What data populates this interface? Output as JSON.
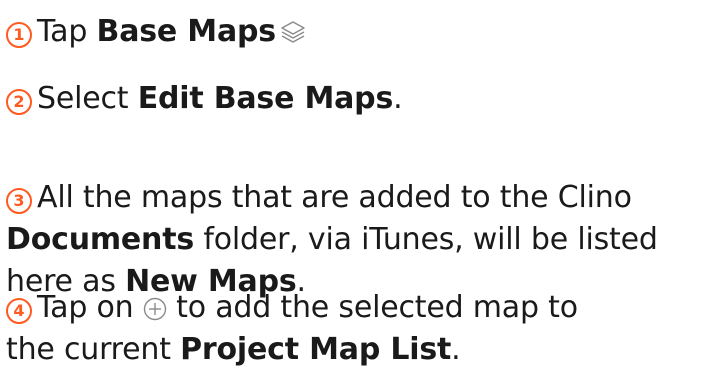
{
  "colors": {
    "badge": "#ff5a1f",
    "text": "#1a1a1a",
    "icon": "#8a8a8a"
  },
  "steps": [
    {
      "number": "1",
      "prefix": "Tap ",
      "bold": "Base Maps",
      "icon": "layers-icon"
    },
    {
      "number": "2",
      "prefix": "Select ",
      "bold": "Edit Base Maps",
      "suffix": "."
    },
    {
      "number": "3",
      "line1": "All the maps that are added to the Clino",
      "bold1": "Documents",
      "rest1": " folder, via iTunes, will be listed",
      "line3_prefix": "here as ",
      "bold2": "New Maps",
      "suffix": "."
    },
    {
      "number": "4",
      "prefix": "Tap on ",
      "icon": "plus-circle-icon",
      "rest": " to add the selected map to",
      "line2_prefix": "the current ",
      "bold": "Project Map List",
      "suffix": "."
    }
  ]
}
